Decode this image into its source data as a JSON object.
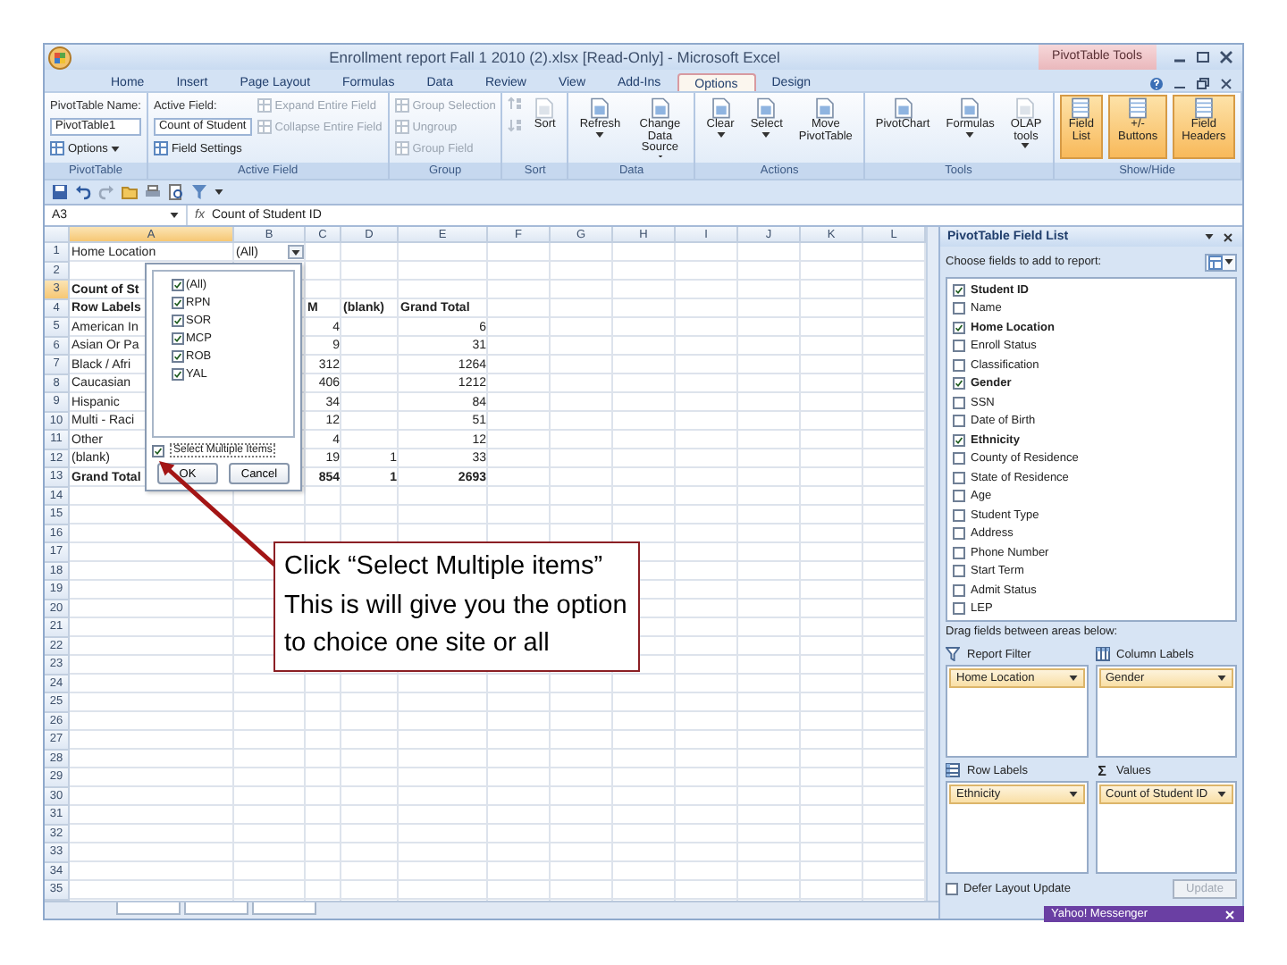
{
  "window": {
    "title": "Enrollment report Fall 1 2010 (2).xlsx  [Read-Only] - Microsoft Excel",
    "context_group": "PivotTable Tools"
  },
  "tabs": [
    {
      "label": "Home",
      "selected": false
    },
    {
      "label": "Insert",
      "selected": false
    },
    {
      "label": "Page Layout",
      "selected": false
    },
    {
      "label": "Formulas",
      "selected": false
    },
    {
      "label": "Data",
      "selected": false
    },
    {
      "label": "Review",
      "selected": false
    },
    {
      "label": "View",
      "selected": false
    },
    {
      "label": "Add-Ins",
      "selected": false
    },
    {
      "label": "Options",
      "selected": true
    },
    {
      "label": "Design",
      "selected": false
    }
  ],
  "ribbon_groups": [
    {
      "label": "PivotTable",
      "items": [
        {
          "kind": "label",
          "text": "PivotTable Name:"
        },
        {
          "kind": "field",
          "value": "PivotTable1"
        },
        {
          "kind": "small",
          "text": "Options",
          "menu": true,
          "disabled": false
        }
      ]
    },
    {
      "label": "Active Field",
      "items": [
        {
          "kind": "label",
          "text": "Active Field:"
        },
        {
          "kind": "field",
          "value": "Count of Student"
        },
        {
          "kind": "small",
          "text": "Field Settings",
          "menu": false,
          "disabled": false
        },
        {
          "kind": "small",
          "text": "Expand Entire Field",
          "menu": false,
          "disabled": true
        },
        {
          "kind": "small",
          "text": "Collapse Entire Field",
          "menu": false,
          "disabled": true
        }
      ]
    },
    {
      "label": "Group",
      "items": [
        {
          "kind": "small",
          "text": "Group Selection",
          "menu": false,
          "disabled": true
        },
        {
          "kind": "small",
          "text": "Ungroup",
          "menu": false,
          "disabled": true
        },
        {
          "kind": "small",
          "text": "Group Field",
          "menu": false,
          "disabled": true
        }
      ]
    },
    {
      "label": "Sort",
      "items": [
        {
          "kind": "sort_ascending",
          "disabled": true
        },
        {
          "kind": "sort_descending",
          "disabled": true
        },
        {
          "kind": "large",
          "text": "Sort",
          "menu": false,
          "disabled": true
        }
      ]
    },
    {
      "label": "Data",
      "items": [
        {
          "kind": "large",
          "text": "Refresh",
          "menu": true,
          "disabled": false
        },
        {
          "kind": "large",
          "text": "Change Data Source",
          "menu": true,
          "disabled": false
        }
      ]
    },
    {
      "label": "Actions",
      "items": [
        {
          "kind": "large",
          "text": "Clear",
          "menu": true,
          "disabled": false
        },
        {
          "kind": "large",
          "text": "Select",
          "menu": true,
          "disabled": false
        },
        {
          "kind": "large",
          "text": "Move PivotTable",
          "menu": false,
          "disabled": false
        }
      ]
    },
    {
      "label": "Tools",
      "items": [
        {
          "kind": "large",
          "text": "PivotChart",
          "menu": false,
          "disabled": false
        },
        {
          "kind": "large",
          "text": "Formulas",
          "menu": true,
          "disabled": false
        },
        {
          "kind": "large",
          "text": "OLAP tools",
          "menu": true,
          "disabled": true
        }
      ]
    },
    {
      "label": "Show/Hide",
      "items": [
        {
          "kind": "toggle",
          "text": "Field List",
          "on": true
        },
        {
          "kind": "toggle",
          "text": "+/- Buttons",
          "on": true
        },
        {
          "kind": "toggle",
          "text": "Field Headers",
          "on": true
        }
      ]
    }
  ],
  "formula_bar": {
    "name_box": "A3",
    "function_label": "fx",
    "formula": "Count of Student ID"
  },
  "sheet": {
    "columns": [
      {
        "label": "A",
        "selected": true
      },
      {
        "label": "B",
        "selected": false
      },
      {
        "label": "C",
        "selected": false
      },
      {
        "label": "D",
        "selected": false
      },
      {
        "label": "E",
        "selected": false
      },
      {
        "label": "F",
        "selected": false
      },
      {
        "label": "G",
        "selected": false
      },
      {
        "label": "H",
        "selected": false
      },
      {
        "label": "I",
        "selected": false
      },
      {
        "label": "J",
        "selected": false
      },
      {
        "label": "K",
        "selected": false
      },
      {
        "label": "L",
        "selected": false
      }
    ],
    "rows": [
      {
        "label": "1",
        "selected": false
      },
      {
        "label": "2",
        "selected": false
      },
      {
        "label": "3",
        "selected": true
      },
      {
        "label": "4",
        "selected": false
      },
      {
        "label": "5",
        "selected": false
      },
      {
        "label": "6",
        "selected": false
      },
      {
        "label": "7",
        "selected": false
      },
      {
        "label": "8",
        "selected": false
      },
      {
        "label": "9",
        "selected": false
      },
      {
        "label": "10",
        "selected": false
      },
      {
        "label": "11",
        "selected": false
      },
      {
        "label": "12",
        "selected": false
      },
      {
        "label": "13",
        "selected": false
      },
      {
        "label": "14",
        "selected": false
      },
      {
        "label": "15",
        "selected": false
      },
      {
        "label": "16",
        "selected": false
      },
      {
        "label": "17",
        "selected": false
      },
      {
        "label": "18",
        "selected": false
      },
      {
        "label": "19",
        "selected": false
      },
      {
        "label": "20",
        "selected": false
      },
      {
        "label": "21",
        "selected": false
      },
      {
        "label": "22",
        "selected": false
      },
      {
        "label": "23",
        "selected": false
      },
      {
        "label": "24",
        "selected": false
      },
      {
        "label": "25",
        "selected": false
      },
      {
        "label": "26",
        "selected": false
      },
      {
        "label": "27",
        "selected": false
      },
      {
        "label": "28",
        "selected": false
      },
      {
        "label": "29",
        "selected": false
      },
      {
        "label": "30",
        "selected": false
      },
      {
        "label": "31",
        "selected": false
      },
      {
        "label": "32",
        "selected": false
      },
      {
        "label": "33",
        "selected": false
      },
      {
        "label": "34",
        "selected": false
      },
      {
        "label": "35",
        "selected": false
      }
    ],
    "pivot": {
      "filter_field": "Home Location",
      "filter_value": "(All)",
      "value_header": "Count of St",
      "header_row": {
        "label": "Row Labels",
        "column_c": "M",
        "column_d": "(blank)",
        "column_e": "Grand Total"
      },
      "rows": [
        {
          "label": "American In",
          "column_c": "4",
          "column_e": "6"
        },
        {
          "label": "Asian Or Pa",
          "column_c": "9",
          "column_e": "31"
        },
        {
          "label": "Black / Afri",
          "column_c": "312",
          "column_e": "1264"
        },
        {
          "label": "Caucasian",
          "column_c": "406",
          "column_e": "1212"
        },
        {
          "label": "Hispanic",
          "column_c": "34",
          "column_e": "84"
        },
        {
          "label": "Multi - Raci",
          "column_c": "12",
          "column_e": "51"
        },
        {
          "label": "Other",
          "column_c": "4",
          "column_e": "12"
        },
        {
          "label": "(blank)",
          "column_c": "19",
          "column_d": "1",
          "column_e": "33"
        }
      ],
      "total_row": {
        "label": "Grand Total",
        "column_c": "854",
        "column_d": "1",
        "column_e": "2693"
      }
    }
  },
  "filter_dropdown": {
    "items": [
      {
        "label": "(All)",
        "checked": true
      },
      {
        "label": "RPN",
        "checked": true
      },
      {
        "label": "SOR",
        "checked": true
      },
      {
        "label": "MCP",
        "checked": true
      },
      {
        "label": "ROB",
        "checked": true
      },
      {
        "label": "YAL",
        "checked": true
      }
    ],
    "select_multiple": {
      "label": "Select Multiple Items",
      "checked": true
    },
    "buttons": [
      "OK",
      "Cancel"
    ]
  },
  "annotation": {
    "text": "Click “Select Multiple items”  This is will give you the option to choice one site or all"
  },
  "field_list": {
    "title": "PivotTable Field List",
    "prompt": "Choose fields to add to report:",
    "fields": [
      {
        "label": "Student ID",
        "checked": true
      },
      {
        "label": "Name",
        "checked": false
      },
      {
        "label": "Home Location",
        "checked": true
      },
      {
        "label": "Enroll Status",
        "checked": false
      },
      {
        "label": "Classification",
        "checked": false
      },
      {
        "label": "Gender",
        "checked": true
      },
      {
        "label": "SSN",
        "checked": false
      },
      {
        "label": "Date of Birth",
        "checked": false
      },
      {
        "label": "Ethnicity",
        "checked": true
      },
      {
        "label": "County of Residence",
        "checked": false
      },
      {
        "label": "State of Residence",
        "checked": false
      },
      {
        "label": "Age",
        "checked": false
      },
      {
        "label": "Student Type",
        "checked": false
      },
      {
        "label": "Address",
        "checked": false
      },
      {
        "label": "Phone Number",
        "checked": false
      },
      {
        "label": "Start Term",
        "checked": false
      },
      {
        "label": "Admit Status",
        "checked": false
      },
      {
        "label": "LEP",
        "checked": false
      }
    ],
    "areas_prompt": "Drag fields between areas below:",
    "areas": [
      {
        "kind": "filter",
        "label": "Report Filter",
        "fields": [
          "Home Location"
        ]
      },
      {
        "kind": "columns",
        "label": "Column Labels",
        "fields": [
          "Gender"
        ]
      },
      {
        "kind": "rows",
        "label": "Row Labels",
        "fields": [
          "Ethnicity"
        ]
      },
      {
        "kind": "values",
        "label": "Values",
        "symbol": "Σ",
        "fields": [
          "Count of Student ID"
        ]
      }
    ],
    "defer": {
      "label": "Defer Layout Update",
      "checked": false
    },
    "update_button": {
      "label": "Update",
      "disabled": true
    }
  },
  "messenger": {
    "title": "Yahoo! Messenger"
  }
}
